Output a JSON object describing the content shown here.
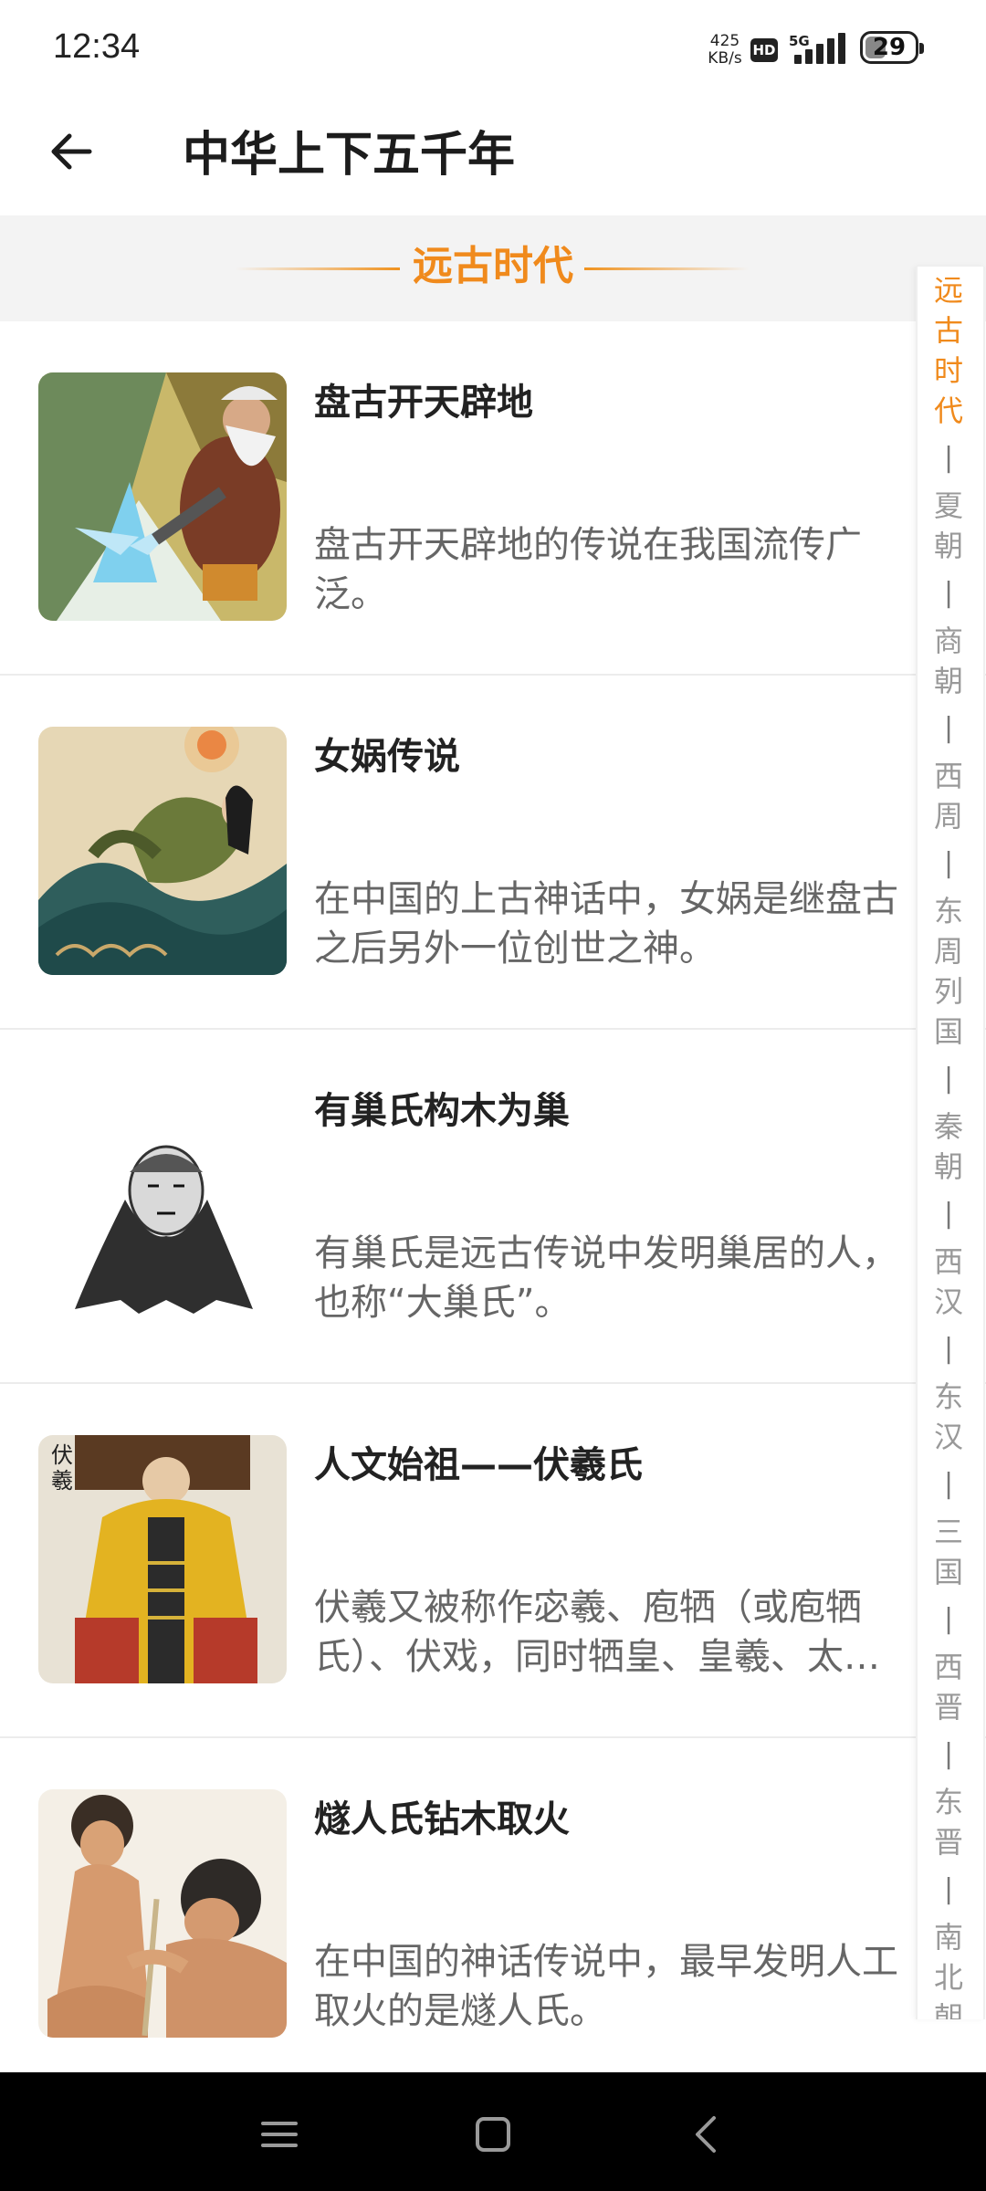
{
  "status": {
    "time": "12:34",
    "net_speed_value": "425",
    "net_speed_unit": "KB/s",
    "hd": "HD",
    "network": "5G",
    "battery": "29"
  },
  "header": {
    "title": "中华上下五千年"
  },
  "section": {
    "title": "远古时代"
  },
  "items": [
    {
      "title": "盘古开天辟地",
      "desc": "盘古开天辟地的传说在我国流传广泛。"
    },
    {
      "title": "女娲传说",
      "desc": "在中国的上古神话中，女娲是继盘古之后另外一位创世之神。"
    },
    {
      "title": "有巢氏构木为巢",
      "desc": "有巢氏是远古传说中发明巢居的人，也称“大巢氏”。"
    },
    {
      "title": "人文始祖——伏羲氏",
      "desc": "伏羲又被称作宓羲、庖牺（或庖牺氏）、伏戏，同时牺皇、皇羲、太…"
    },
    {
      "title": "燧人氏钻木取火",
      "desc": "在中国的神话传说中，最早发明人工取火的是燧人氏。"
    }
  ],
  "timeline": {
    "separator": "|",
    "eras": [
      "远古时代",
      "夏朝",
      "商朝",
      "西周",
      "东周列国",
      "秦朝",
      "西汉",
      "东汉",
      "三国",
      "西晋",
      "东晋",
      "南北朝"
    ]
  }
}
